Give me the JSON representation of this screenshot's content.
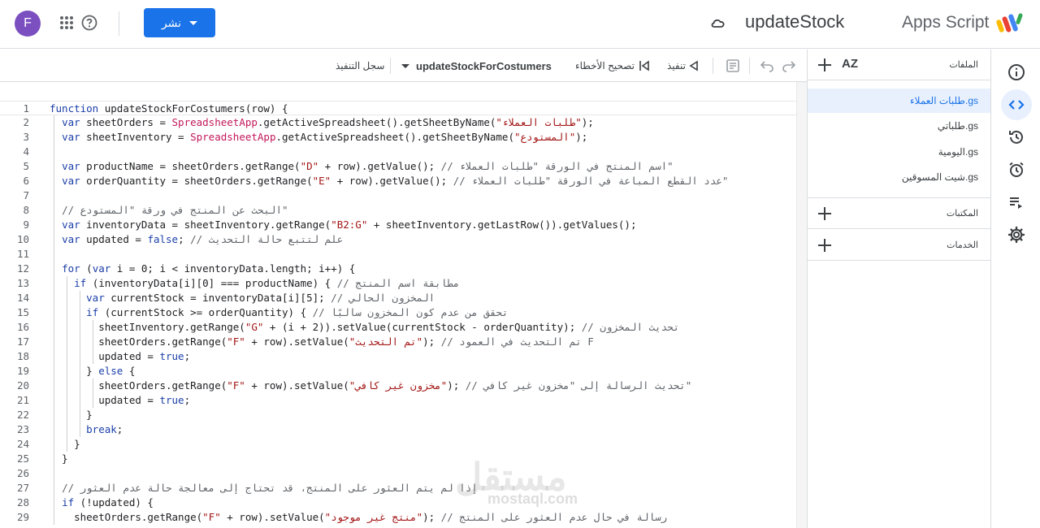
{
  "topbar": {
    "avatar_letter": "F",
    "deploy_label": "نشر",
    "project_title": "updateStock",
    "product_name": "Apps Script"
  },
  "toolbar": {
    "execution_log": "سجل التنفيذ",
    "function_name": "updateStockForCostumers",
    "debug": "تصحيح الأخطاء",
    "run": "تنفيذ"
  },
  "files": {
    "header": "الملفات",
    "sort_label": "AZ",
    "items": [
      "طلبات العملاء.gs",
      "طلباتي.gs",
      "اليومية.gs",
      "شيت المسوقين.gs"
    ],
    "libraries": "المكتبات",
    "services": "الخدمات"
  },
  "code": {
    "lines": [
      "function updateStockForCostumers(row) {",
      "  var sheetOrders = SpreadsheetApp.getActiveSpreadsheet().getSheetByName(\"طلبات العملاء\");",
      "  var sheetInventory = SpreadsheetApp.getActiveSpreadsheet().getSheetByName(\"المستودع\");",
      "",
      "  var productName = sheetOrders.getRange(\"D\" + row).getValue(); // اسم المنتج في الورقة \"طلبات العملاء\"",
      "  var orderQuantity = sheetOrders.getRange(\"E\" + row).getValue(); // عدد القطع المباعة في الورقة \"طلبات العملاء\"",
      "",
      "  // البحث عن المنتج في ورقة \"المستودع\"",
      "  var inventoryData = sheetInventory.getRange(\"B2:G\" + sheetInventory.getLastRow()).getValues();",
      "  var updated = false; // علم لتتبع حالة التحديث",
      "",
      "  for (var i = 0; i < inventoryData.length; i++) {",
      "    if (inventoryData[i][0] === productName) { // مطابقة اسم المنتج",
      "      var currentStock = inventoryData[i][5]; // المخزون الحالي",
      "      if (currentStock >= orderQuantity) { // تحقق من عدم كون المخزون سالبًا",
      "        sheetInventory.getRange(\"G\" + (i + 2)).setValue(currentStock - orderQuantity); // تحديث المخزون",
      "        sheetOrders.getRange(\"F\" + row).setValue(\"تم التحديث\"); // تم التحديث في العمود F",
      "        updated = true;",
      "      } else {",
      "        sheetOrders.getRange(\"F\" + row).setValue(\"مخزون غير كافي\"); // تحديث الرسالة إلى \"مخزون غير كافي\"",
      "        updated = true;",
      "      }",
      "      break;",
      "    }",
      "  }",
      "",
      "  // إذا لم يتم العثور على المنتج، قد تحتاج إلى معالجة حالة عدم العثور",
      "  if (!updated) {",
      "    sheetOrders.getRange(\"F\" + row).setValue(\"منتج غير موجود\"); // رسالة في حال عدم العثور على المنتج"
    ]
  },
  "watermark": {
    "main": "مستقل",
    "sub": "mostaql.com"
  },
  "colors": {
    "accent": "#1a73e8",
    "keyword": "#1a3ea8",
    "class": "#c2185b",
    "string": "#a31515"
  }
}
